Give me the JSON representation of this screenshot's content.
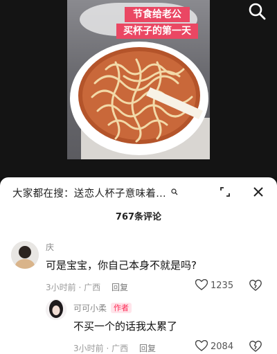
{
  "video": {
    "caption_line1": "节食给老公",
    "caption_line2": "买杯子的第一天",
    "search_icon": "search-icon"
  },
  "comments_panel": {
    "hot_search_text": "大家都在搜：送恋人杯子意味着...",
    "comment_count_label": "767条评论",
    "icons": [
      "mini-search-icon",
      "expand-icon",
      "close-icon"
    ]
  },
  "comments": [
    {
      "username": "庆",
      "text": "可是宝宝，你自己本身不就是吗?",
      "time": "3小时前",
      "location": "广西",
      "reply_label": "回复",
      "likes": "1235"
    },
    {
      "username": "可可小柔",
      "author_badge": "作者",
      "text": "不买一个的话我太累了",
      "time": "3小时前",
      "location": "广西",
      "reply_label": "回复",
      "likes": "2084"
    }
  ],
  "colors": {
    "caption_bg": "#ea4763",
    "author_badge": "#fe2c55"
  }
}
